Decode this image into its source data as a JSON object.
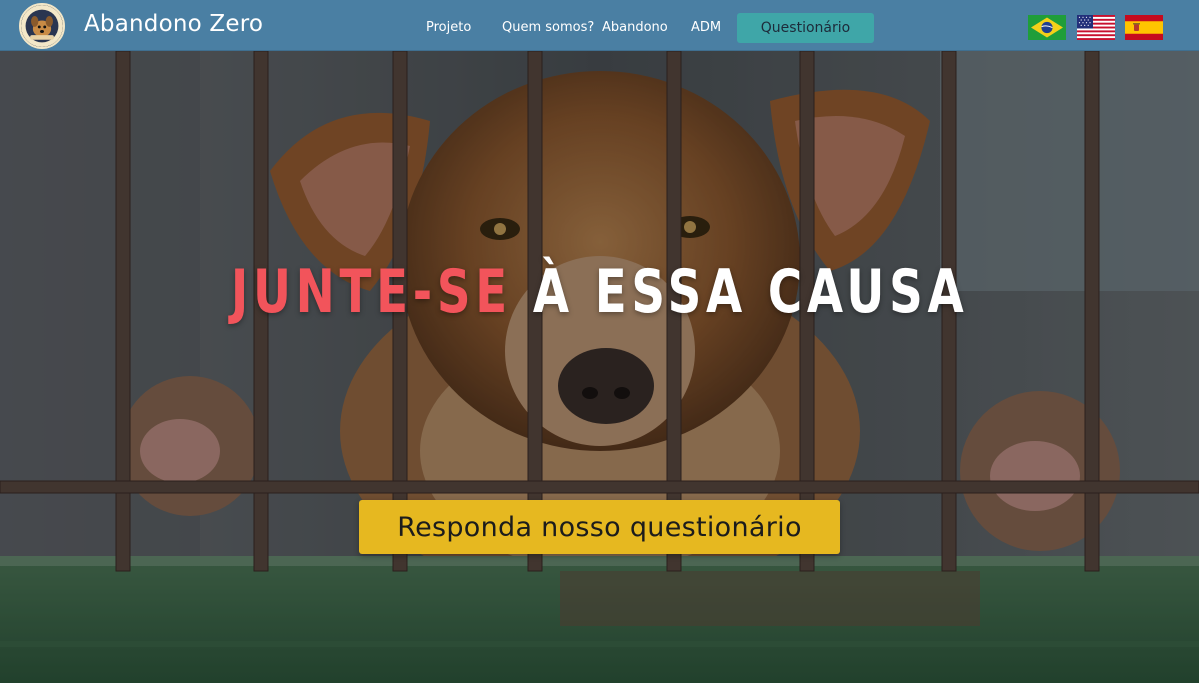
{
  "navbar": {
    "logo_icon": "dog-logo-icon",
    "brand": "Abandono Zero",
    "links": [
      {
        "label": "Projeto"
      },
      {
        "label": "Quem somos?"
      },
      {
        "label": "Abandono"
      },
      {
        "label": "ADM"
      }
    ],
    "cta_label": "Questionário",
    "flags": [
      "brazil-flag-icon",
      "usa-flag-icon",
      "spain-flag-icon"
    ]
  },
  "hero": {
    "headline_accent": "JUNTE-SE",
    "headline_rest": " À ESSA CAUSA",
    "cta_label": "Responda nosso questionário",
    "image_icon": "caged-dog-photo"
  },
  "colors": {
    "navbar": "#4a7fa3",
    "nav_cta": "#3fa6a8",
    "accent_text": "#f2545b",
    "hero_cta": "#e6b820"
  }
}
